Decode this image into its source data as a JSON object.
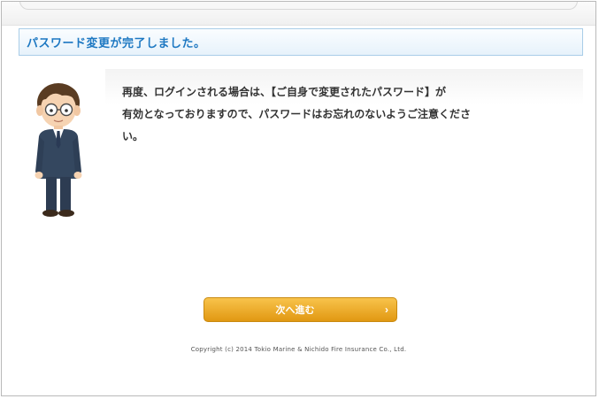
{
  "title": "パスワード変更が完了しました。",
  "message": {
    "line1": "再度、ログインされる場合は、【ご自身で変更されたパスワード】が",
    "line2": "有効となっておりますので、パスワードはお忘れのないようご注意くださ",
    "line3": "い。"
  },
  "next_button": {
    "label": "次へ進む",
    "chevron": "›"
  },
  "footer": {
    "copyright": "Copyright (c) 2014 Tokio Marine & Nichido Fire Insurance Co., Ltd."
  },
  "colors": {
    "title_text": "#1d78c2",
    "title_border": "#a9cde8",
    "button_top": "#f8c34b",
    "button_bottom": "#e19812"
  }
}
